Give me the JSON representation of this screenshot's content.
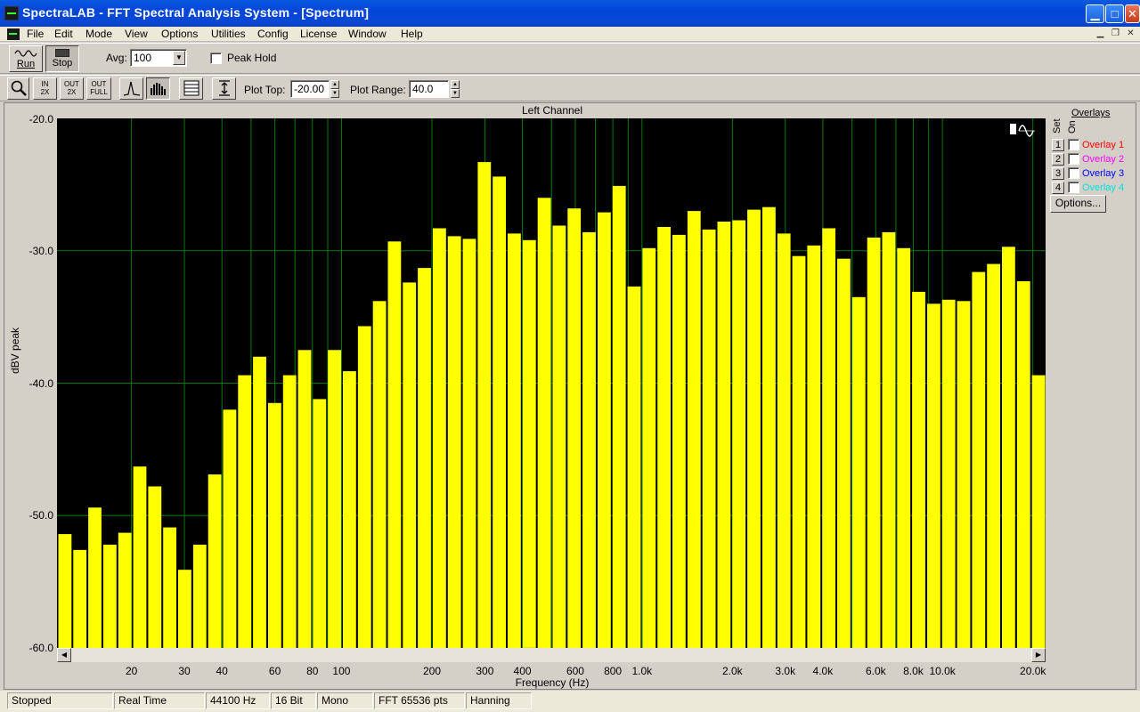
{
  "window": {
    "title": "SpectraLAB - FFT Spectral Analysis System - [Spectrum]",
    "close_icon": "close-icon",
    "min_icon": "minimize-icon",
    "max_icon": "maximize-icon"
  },
  "menu": [
    "File",
    "Edit",
    "Mode",
    "View",
    "Options",
    "Utilities",
    "Config",
    "License",
    "Window",
    "Help"
  ],
  "toolbar1": {
    "run_label": "Run",
    "stop_label": "Stop",
    "avg_label": "Avg:",
    "avg_value": "100",
    "peak_hold_label": "Peak Hold",
    "peak_hold_checked": false
  },
  "toolbar2": {
    "zoom_in_2x": "2X",
    "zoom_out_2x": "2X",
    "zoom_out_full": "FULL",
    "in_label": "IN",
    "out_label": "OUT",
    "plot_top_label": "Plot Top:",
    "plot_top_value": "-20.00",
    "plot_range_label": "Plot Range:",
    "plot_range_value": "40.0"
  },
  "overlays": {
    "header": "Overlays",
    "set_label": "Set",
    "on_label": "On",
    "items": [
      {
        "num": "1",
        "label": "Overlay 1",
        "color": "#ff0000"
      },
      {
        "num": "2",
        "label": "Overlay 2",
        "color": "#ff00ff"
      },
      {
        "num": "3",
        "label": "Overlay 3",
        "color": "#0000ff"
      },
      {
        "num": "4",
        "label": "Overlay 4",
        "color": "#00e0e0"
      }
    ],
    "options_label": "Options..."
  },
  "status": [
    "Stopped",
    "Real Time",
    "44100 Hz",
    "16 Bit",
    "Mono",
    "FFT 65536 pts",
    "Hanning"
  ],
  "chart_data": {
    "type": "bar",
    "title": "Left Channel",
    "xlabel": "Frequency (Hz)",
    "ylabel": "dBV peak",
    "x_scale": "log",
    "xlim": [
      11.3,
      22050
    ],
    "ylim": [
      -60,
      -20
    ],
    "y_ticks": [
      "-20.0",
      "-30.0",
      "-40.0",
      "-50.0",
      "-60.0"
    ],
    "x_ticks": [
      {
        "label": "20",
        "value": 20
      },
      {
        "label": "30",
        "value": 30
      },
      {
        "label": "40",
        "value": 40
      },
      {
        "label": "60",
        "value": 60
      },
      {
        "label": "80",
        "value": 80
      },
      {
        "label": "100",
        "value": 100
      },
      {
        "label": "200",
        "value": 200
      },
      {
        "label": "300",
        "value": 300
      },
      {
        "label": "400",
        "value": 400
      },
      {
        "label": "600",
        "value": 600
      },
      {
        "label": "800",
        "value": 800
      },
      {
        "label": "1.0k",
        "value": 1000
      },
      {
        "label": "2.0k",
        "value": 2000
      },
      {
        "label": "3.0k",
        "value": 3000
      },
      {
        "label": "4.0k",
        "value": 4000
      },
      {
        "label": "6.0k",
        "value": 6000
      },
      {
        "label": "8.0k",
        "value": 8000
      },
      {
        "label": "10.0k",
        "value": 10000
      },
      {
        "label": "20.0k",
        "value": 20000
      }
    ],
    "grid_lines": [
      20,
      30,
      40,
      50,
      60,
      70,
      80,
      90,
      100,
      200,
      300,
      400,
      500,
      600,
      700,
      800,
      900,
      1000,
      2000,
      3000,
      4000,
      5000,
      6000,
      7000,
      8000,
      9000,
      10000,
      20000
    ],
    "bar_color": "#ffff00",
    "background": "#000000",
    "grid_color": "#0a7a0a",
    "values": [
      -51.4,
      -52.6,
      -49.4,
      -52.2,
      -51.3,
      -46.3,
      -47.8,
      -50.9,
      -54.1,
      -52.2,
      -46.9,
      -42.0,
      -39.4,
      -38.0,
      -41.5,
      -39.4,
      -37.5,
      -41.2,
      -37.5,
      -39.1,
      -35.7,
      -33.8,
      -29.3,
      -32.4,
      -31.3,
      -28.3,
      -28.9,
      -29.1,
      -23.3,
      -24.4,
      -28.7,
      -29.2,
      -26.0,
      -28.1,
      -26.8,
      -28.6,
      -27.1,
      -25.1,
      -32.7,
      -29.8,
      -28.2,
      -28.8,
      -27.0,
      -28.4,
      -27.8,
      -27.7,
      -26.9,
      -26.7,
      -28.7,
      -30.4,
      -29.6,
      -28.3,
      -30.6,
      -33.5,
      -29.0,
      -28.6,
      -29.8,
      -33.1,
      -34.0,
      -33.7,
      -33.8,
      -31.6,
      -31.0,
      -29.7,
      -32.3,
      -39.4
    ]
  }
}
